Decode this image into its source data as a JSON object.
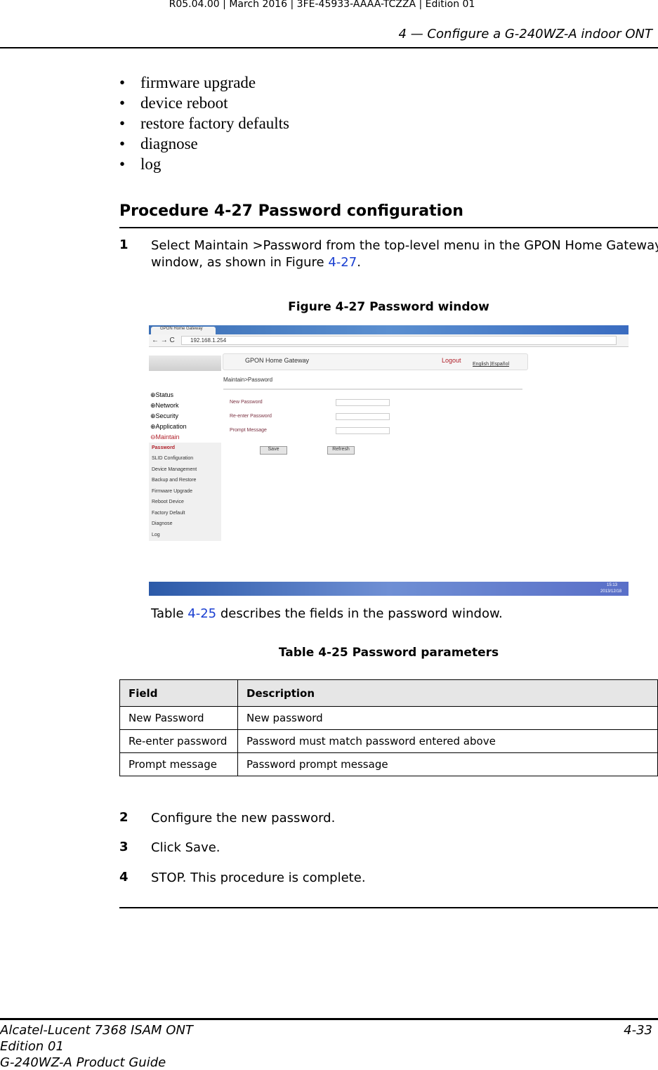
{
  "header": {
    "top_line": "R05.04.00 | March 2016 | 3FE-45933-AAAA-TCZZA | Edition 01",
    "chapter": "4 — Configure a G-240WZ-A indoor ONT"
  },
  "bullets": [
    "firmware upgrade",
    "device reboot",
    "restore factory defaults",
    "diagnose",
    "log"
  ],
  "procedure": {
    "title": "Procedure 4-27  Password configuration",
    "step1": {
      "num": "1",
      "line1": "Select Maintain >Password from the top-level menu in the GPON Home Gateway",
      "line2_pre": "window, as shown in Figure ",
      "line2_link": "4-27",
      "line2_post": "."
    },
    "figure_caption": "Figure 4-27  Password window",
    "table_ref": {
      "pre": "Table ",
      "link": "4-25",
      "post": " describes the fields in the password window."
    },
    "table_caption": "Table 4-25 Password parameters",
    "table": {
      "headers": [
        "Field",
        "Description"
      ],
      "rows": [
        [
          "New Password",
          "New password"
        ],
        [
          "Re-enter password",
          "Password must match password entered above"
        ],
        [
          "Prompt message",
          "Password prompt message"
        ]
      ]
    },
    "steps": [
      {
        "num": "2",
        "text": "Configure the new password."
      },
      {
        "num": "3",
        "text": "Click Save."
      },
      {
        "num": "4",
        "text": "STOP. This procedure is complete."
      }
    ]
  },
  "screenshot": {
    "tab_title": "GPON Home Gateway",
    "url": "192.168.1.254",
    "banner_title": "GPON Home Gateway",
    "logout": "Logout",
    "languages": "English |Español",
    "breadcrumb": "Maintain>Password",
    "menu": [
      "Status",
      "Network",
      "Security",
      "Application",
      "Maintain"
    ],
    "submenu": [
      "Password",
      "SLID Configuration",
      "Device Management",
      "Backup and Restore",
      "Firmware Upgrade",
      "Reboot Device",
      "Factory Default",
      "Diagnose",
      "Log"
    ],
    "fields": [
      "New Password",
      "Re-enter Password",
      "Prompt Message"
    ],
    "save": "Save",
    "refresh": "Refresh",
    "clock_time": "15:13",
    "clock_date": "2013/12/18",
    "accent": "#b0202a"
  },
  "footer": {
    "line1": "Alcatel-Lucent 7368 ISAM ONT",
    "line2": "Edition 01",
    "line3": "G-240WZ-A Product Guide",
    "page": "4-33"
  }
}
